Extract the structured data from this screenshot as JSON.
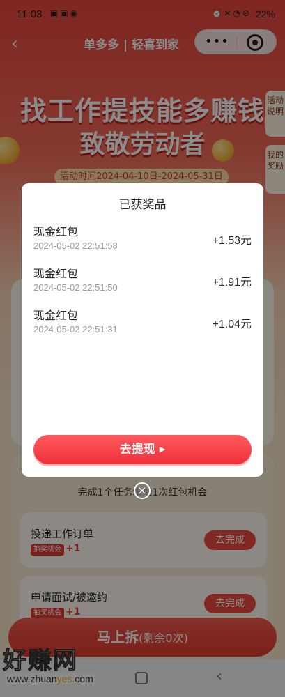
{
  "status_bar": {
    "time": "11:03",
    "battery": "22%"
  },
  "nav": {
    "back_icon": "chevron-left-icon",
    "brand": "单多多 | 轻喜到家",
    "menu_icon": "more-dots-icon",
    "close_icon": "target-close-icon"
  },
  "banner": {
    "title": "找工作提技能多赚钱",
    "subtitle": "致敬劳动者",
    "date": "活动时间2024-04-10日-2024-05-31日"
  },
  "side_tabs": {
    "rules": "活动说明",
    "prizes": "我的奖励"
  },
  "tasks": {
    "summary": "完成1个任务增加1次红包机会",
    "items": [
      {
        "name": "投递工作订单",
        "tag": "抽奖机会",
        "bonus": "+1",
        "action": "去完成"
      },
      {
        "name": "申请面试/被邀约",
        "tag": "抽奖机会",
        "bonus": "+1",
        "action": "去完成"
      }
    ]
  },
  "bottom_button": {
    "label": "马上拆",
    "remaining": "(剩余0次)"
  },
  "watermark": {
    "title": "好赚网",
    "url_pre": "www.zhuan",
    "url_accent": "yes",
    "url_post": ".com"
  },
  "modal": {
    "title": "已获奖品",
    "prizes": [
      {
        "name": "现金红包",
        "time": "2024-05-02 22:51:58",
        "amount": "+1.53元"
      },
      {
        "name": "现金红包",
        "time": "2024-05-02 22:51:50",
        "amount": "+1.91元"
      },
      {
        "name": "现金红包",
        "time": "2024-05-02 22:51:31",
        "amount": "+1.04元"
      }
    ],
    "withdraw_label": "去提现",
    "withdraw_icon": "play-arrow-icon",
    "close_icon": "close-circle-icon"
  },
  "colors": {
    "primary_red": "#ee2f3a",
    "banner_red": "#e8453d",
    "overlay": "rgba(0,0,0,0.45)"
  }
}
